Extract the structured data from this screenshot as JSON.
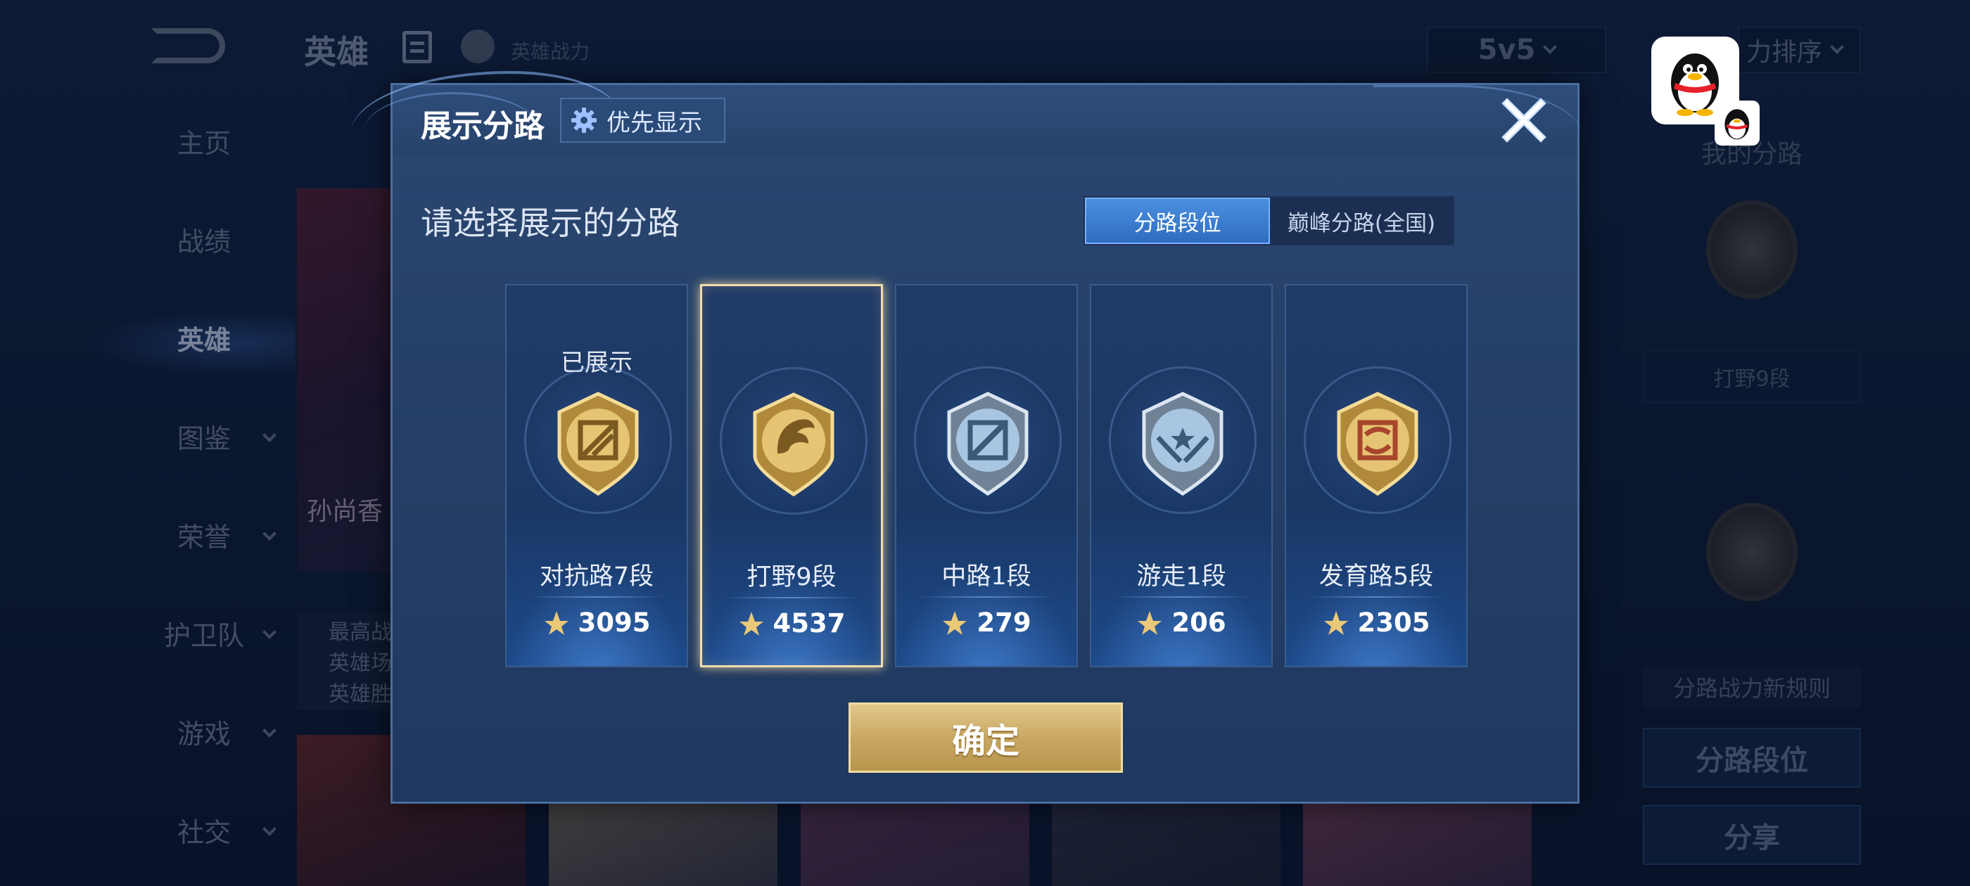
{
  "background": {
    "page_title": "英雄",
    "power_label": "英雄战力",
    "mode_select": "5v5",
    "sort_select": "力排序",
    "nav": [
      {
        "label": "主页",
        "expandable": false,
        "active": false
      },
      {
        "label": "战绩",
        "expandable": false,
        "active": false
      },
      {
        "label": "英雄",
        "expandable": false,
        "active": true
      },
      {
        "label": "图鉴",
        "expandable": true,
        "active": false
      },
      {
        "label": "荣誉",
        "expandable": true,
        "active": false
      },
      {
        "label": "护卫队",
        "expandable": true,
        "active": false
      },
      {
        "label": "游戏",
        "expandable": true,
        "active": false
      },
      {
        "label": "社交",
        "expandable": true,
        "active": false
      }
    ],
    "hero_name": "孙尚香",
    "hero_stats": [
      "最高战",
      "英雄场",
      "英雄胜"
    ],
    "right_panel": {
      "title": "我的分路",
      "badge_label": "打野9段",
      "rule_label": "分路战力新规则",
      "btn_rank": "分路段位",
      "btn_share": "分享"
    }
  },
  "modal": {
    "title": "展示分路",
    "priority_label": "优先显示",
    "subtitle": "请选择展示的分路",
    "tabs": [
      {
        "label": "分路段位",
        "active": true
      },
      {
        "label": "巅峰分路(全国)",
        "active": false
      }
    ],
    "cards": [
      {
        "lane": "对抗路7段",
        "score": "3095",
        "shown_label": "已展示",
        "icon": "clash-lane-emblem",
        "theme": "gold",
        "selected": false
      },
      {
        "lane": "打野9段",
        "score": "4537",
        "shown_label": "",
        "icon": "jungle-dragon-emblem",
        "theme": "gold",
        "selected": true
      },
      {
        "lane": "中路1段",
        "score": "279",
        "shown_label": "",
        "icon": "mid-lane-emblem",
        "theme": "silver",
        "selected": false
      },
      {
        "lane": "游走1段",
        "score": "206",
        "shown_label": "",
        "icon": "roam-wings-emblem",
        "theme": "silver",
        "selected": false
      },
      {
        "lane": "发育路5段",
        "score": "2305",
        "shown_label": "",
        "icon": "farm-lane-emblem",
        "theme": "gold",
        "selected": false
      }
    ],
    "confirm_label": "确定"
  },
  "colors": {
    "modal_bg": "#27436b",
    "tab_active": "#3a7cd0",
    "gold": "#c9a862",
    "selected_border": "#f1dcae"
  }
}
